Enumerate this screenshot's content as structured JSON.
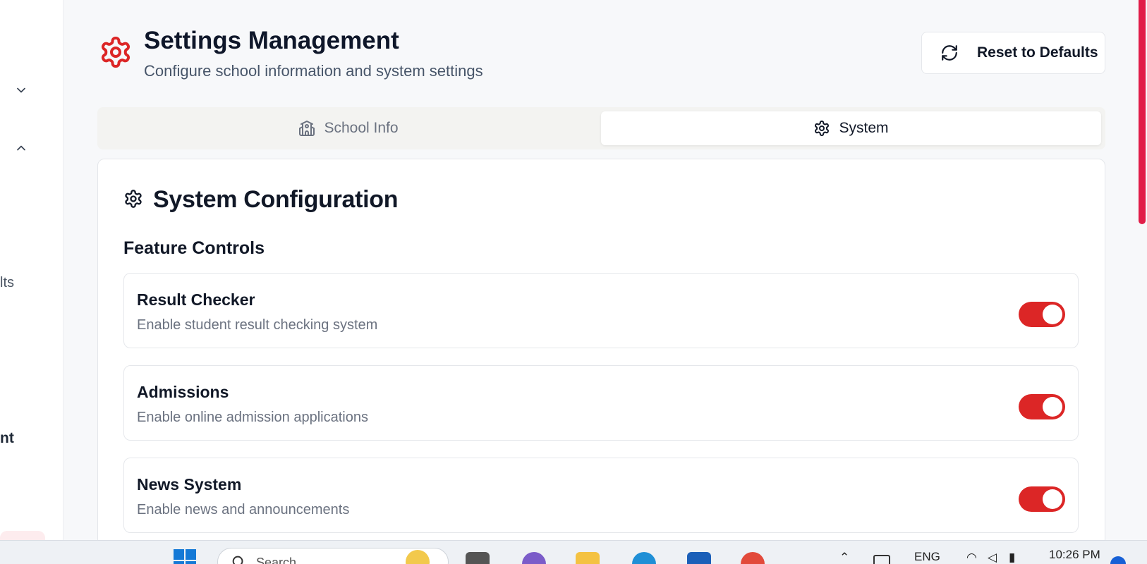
{
  "sidebar": {
    "partial_items": [
      {
        "text": "lts"
      },
      {
        "text": "nt"
      }
    ]
  },
  "header": {
    "title": "Settings Management",
    "subtitle": "Configure school information and system settings",
    "icon": "gear-icon",
    "reset_label": "Reset to Defaults",
    "accent_color": "#dc2626"
  },
  "tabs": [
    {
      "label": "School Info",
      "icon": "school-icon",
      "active": false
    },
    {
      "label": "System",
      "icon": "gear-icon",
      "active": true
    }
  ],
  "card": {
    "title": "System Configuration",
    "section_title": "Feature Controls",
    "features": [
      {
        "name": "Result Checker",
        "description": "Enable student result checking system",
        "enabled": true
      },
      {
        "name": "Admissions",
        "description": "Enable online admission applications",
        "enabled": true
      },
      {
        "name": "News System",
        "description": "Enable news and announcements",
        "enabled": true
      }
    ]
  },
  "taskbar": {
    "search_placeholder": "Search",
    "language": "ENG",
    "time": "10:26 PM"
  }
}
